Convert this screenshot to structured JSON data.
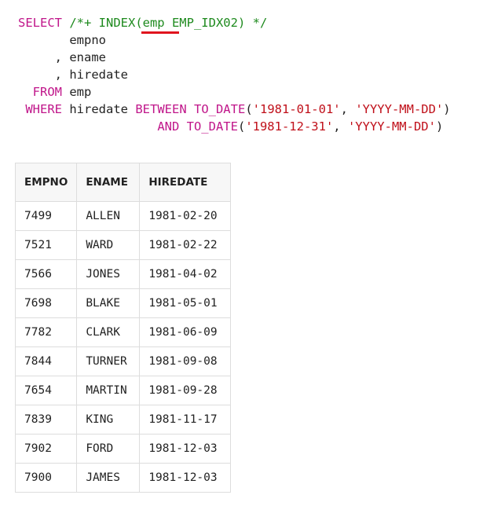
{
  "code": {
    "lines": [
      [
        {
          "cls": "kw",
          "text": "SELECT "
        },
        {
          "cls": "hint",
          "text": "/*+ INDEX(emp EMP_IDX02) */"
        }
      ],
      [
        {
          "cls": "plain",
          "text": "       empno"
        }
      ],
      [
        {
          "cls": "plain",
          "text": "     , ename"
        }
      ],
      [
        {
          "cls": "plain",
          "text": "     , hiredate"
        }
      ],
      [
        {
          "cls": "kw",
          "text": "  FROM "
        },
        {
          "cls": "plain",
          "text": "emp"
        }
      ],
      [
        {
          "cls": "kw",
          "text": " WHERE "
        },
        {
          "cls": "plain",
          "text": "hiredate "
        },
        {
          "cls": "kw",
          "text": "BETWEEN TO_DATE"
        },
        {
          "cls": "plain",
          "text": "("
        },
        {
          "cls": "str",
          "text": "'1981-01-01'"
        },
        {
          "cls": "plain",
          "text": ", "
        },
        {
          "cls": "str",
          "text": "'YYYY-MM-DD'"
        },
        {
          "cls": "plain",
          "text": ")"
        }
      ],
      [
        {
          "cls": "plain",
          "text": "                   "
        },
        {
          "cls": "kw",
          "text": "AND TO_DATE"
        },
        {
          "cls": "plain",
          "text": "("
        },
        {
          "cls": "str",
          "text": "'1981-12-31'"
        },
        {
          "cls": "plain",
          "text": ", "
        },
        {
          "cls": "str",
          "text": "'YYYY-MM-DD'"
        },
        {
          "cls": "plain",
          "text": ")"
        }
      ]
    ]
  },
  "colors": {
    "keyword": "#c0168a",
    "hint": "#1e8a1e",
    "string": "#c0101a",
    "underline": "#e0141e"
  },
  "result": {
    "headers": [
      "EMPNO",
      "ENAME",
      "HIREDATE"
    ],
    "rows": [
      [
        "7499",
        "ALLEN",
        "1981-02-20"
      ],
      [
        "7521",
        "WARD",
        "1981-02-22"
      ],
      [
        "7566",
        "JONES",
        "1981-04-02"
      ],
      [
        "7698",
        "BLAKE",
        "1981-05-01"
      ],
      [
        "7782",
        "CLARK",
        "1981-06-09"
      ],
      [
        "7844",
        "TURNER",
        "1981-09-08"
      ],
      [
        "7654",
        "MARTIN",
        "1981-09-28"
      ],
      [
        "7839",
        "KING",
        "1981-11-17"
      ],
      [
        "7902",
        "FORD",
        "1981-12-03"
      ],
      [
        "7900",
        "JAMES",
        "1981-12-03"
      ]
    ]
  }
}
